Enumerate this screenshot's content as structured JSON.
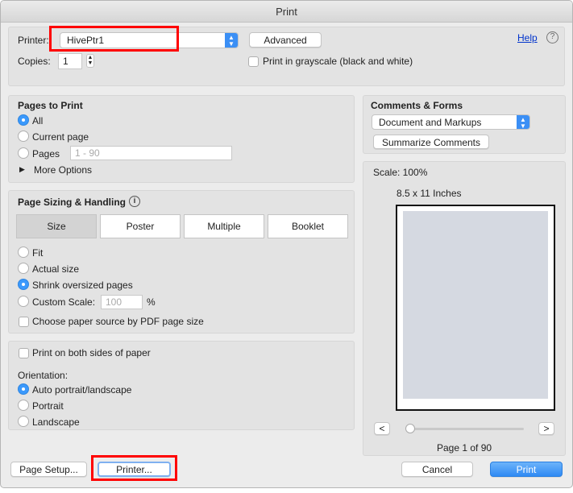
{
  "window": {
    "title": "Print"
  },
  "printer": {
    "label": "Printer:",
    "value": "HivePtr1",
    "advanced": "Advanced",
    "help": "Help",
    "copies_label": "Copies:",
    "copies": "1",
    "grayscale": "Print in grayscale (black and white)"
  },
  "pages": {
    "title": "Pages to Print",
    "all": "All",
    "current": "Current page",
    "pages": "Pages",
    "range_placeholder": "1 - 90",
    "more": "More Options"
  },
  "sizing": {
    "title": "Page Sizing & Handling",
    "tabs": [
      "Size",
      "Poster",
      "Multiple",
      "Booklet"
    ],
    "fit": "Fit",
    "actual": "Actual size",
    "shrink": "Shrink oversized pages",
    "custom": "Custom Scale:",
    "custom_value": "100",
    "percent": "%",
    "paper_source": "Choose paper source by PDF page size"
  },
  "duplex": {
    "both_sides": "Print on both sides of paper",
    "orientation": "Orientation:",
    "auto": "Auto portrait/landscape",
    "portrait": "Portrait",
    "landscape": "Landscape"
  },
  "comments": {
    "title": "Comments & Forms",
    "value": "Document and Markups",
    "summarize": "Summarize Comments"
  },
  "preview": {
    "scale": "Scale: 100%",
    "paper": "8.5 x 11 Inches",
    "prev": "<",
    "next": ">",
    "page": "Page 1 of 90"
  },
  "footer": {
    "page_setup": "Page Setup...",
    "printer": "Printer...",
    "cancel": "Cancel",
    "print": "Print"
  }
}
